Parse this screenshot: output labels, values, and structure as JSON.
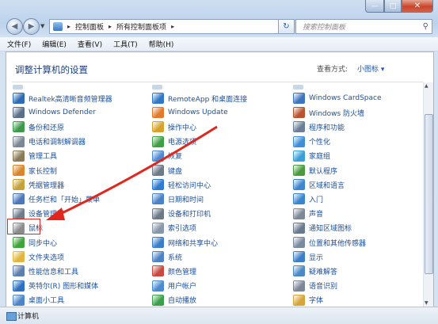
{
  "window": {
    "min_glyph": "—",
    "max_glyph": "□",
    "close_glyph": "✕"
  },
  "nav": {
    "back_glyph": "◀",
    "forward_glyph": "▶",
    "breadcrumbs": [
      "控制面板",
      "所有控制面板项"
    ],
    "breadcrumb_sep": "▸",
    "search_placeholder": "搜索控制面板",
    "refresh_glyph": "↻",
    "search_glyph": "⚲"
  },
  "menu": [
    {
      "label": "文件(F)"
    },
    {
      "label": "编辑(E)"
    },
    {
      "label": "查看(V)"
    },
    {
      "label": "工具(T)"
    },
    {
      "label": "帮助(H)"
    }
  ],
  "header": {
    "title": "调整计算机的设置",
    "view_by_label": "查看方式:",
    "view_by_value": "小图标 ▾"
  },
  "columns": [
    [
      {
        "label": "Realtek高清晰音频管理器",
        "icon": "speaker-icon",
        "color": "#2e6db4"
      },
      {
        "label": "Windows Defender",
        "icon": "shield-icon",
        "color": "#5b6f8a"
      },
      {
        "label": "备份和还原",
        "icon": "backup-icon",
        "color": "#3c9a4a"
      },
      {
        "label": "电话和调制解调器",
        "icon": "phone-icon",
        "color": "#7c8796"
      },
      {
        "label": "管理工具",
        "icon": "tools-icon",
        "color": "#8a7a55"
      },
      {
        "label": "家长控制",
        "icon": "parental-icon",
        "color": "#d9862b"
      },
      {
        "label": "凭据管理器",
        "icon": "credential-icon",
        "color": "#c4a23a"
      },
      {
        "label": "任务栏和「开始」菜单",
        "icon": "taskbar-icon",
        "color": "#4c77b8"
      },
      {
        "label": "设备管理器",
        "icon": "device-manager-icon",
        "color": "#6f7c8c"
      },
      {
        "label": "鼠标",
        "icon": "mouse-icon",
        "color": "#8c8c8c"
      },
      {
        "label": "同步中心",
        "icon": "sync-icon",
        "color": "#3ea43b"
      },
      {
        "label": "文件夹选项",
        "icon": "folder-icon",
        "color": "#e2b63f"
      },
      {
        "label": "性能信息和工具",
        "icon": "performance-icon",
        "color": "#5d7fb0"
      },
      {
        "label": "英特尔(R) 图形和媒体",
        "icon": "intel-icon",
        "color": "#2d70c2"
      },
      {
        "label": "桌面小工具",
        "icon": "gadgets-icon",
        "color": "#4d86c8"
      }
    ],
    [
      {
        "label": "RemoteApp 和桌面连接",
        "icon": "remoteapp-icon",
        "color": "#3178c6"
      },
      {
        "label": "Windows Update",
        "icon": "update-icon",
        "color": "#e27a2b"
      },
      {
        "label": "操作中心",
        "icon": "flag-icon",
        "color": "#d7a22a"
      },
      {
        "label": "电源选项",
        "icon": "power-icon",
        "color": "#3ea044"
      },
      {
        "label": "恢复",
        "icon": "recovery-icon",
        "color": "#4d8ad1"
      },
      {
        "label": "键盘",
        "icon": "keyboard-icon",
        "color": "#6f7a88"
      },
      {
        "label": "轻松访问中心",
        "icon": "ease-access-icon",
        "color": "#2e7bd0"
      },
      {
        "label": "日期和时间",
        "icon": "clock-icon",
        "color": "#4b82c9"
      },
      {
        "label": "设备和打印机",
        "icon": "printer-icon",
        "color": "#6c7886"
      },
      {
        "label": "索引选项",
        "icon": "index-icon",
        "color": "#8796a8"
      },
      {
        "label": "网络和共享中心",
        "icon": "network-icon",
        "color": "#3b7fc8"
      },
      {
        "label": "系统",
        "icon": "system-icon",
        "color": "#4f83c4"
      },
      {
        "label": "颜色管理",
        "icon": "color-icon",
        "color": "#c9483f"
      },
      {
        "label": "用户帐户",
        "icon": "user-icon",
        "color": "#4a8ad0"
      },
      {
        "label": "自动播放",
        "icon": "autoplay-icon",
        "color": "#3ba04a"
      }
    ],
    [
      {
        "label": "Windows CardSpace",
        "icon": "cardspace-icon",
        "color": "#3c74c0"
      },
      {
        "label": "Windows 防火墙",
        "icon": "firewall-icon",
        "color": "#b9532f"
      },
      {
        "label": "程序和功能",
        "icon": "programs-icon",
        "color": "#6d7f97"
      },
      {
        "label": "个性化",
        "icon": "personalize-icon",
        "color": "#3d8fd8"
      },
      {
        "label": "家庭组",
        "icon": "homegroup-icon",
        "color": "#3a9fd6"
      },
      {
        "label": "默认程序",
        "icon": "default-programs-icon",
        "color": "#4a9a3f"
      },
      {
        "label": "区域和语言",
        "icon": "region-icon",
        "color": "#3f86cf"
      },
      {
        "label": "入门",
        "icon": "getting-started-icon",
        "color": "#3a85cf"
      },
      {
        "label": "声音",
        "icon": "sound-icon",
        "color": "#7c8898"
      },
      {
        "label": "通知区域图标",
        "icon": "notification-icon",
        "color": "#6a7a8e"
      },
      {
        "label": "位置和其他传感器",
        "icon": "sensor-icon",
        "color": "#7a8aa0"
      },
      {
        "label": "显示",
        "icon": "display-icon",
        "color": "#3c7fc8"
      },
      {
        "label": "疑难解答",
        "icon": "troubleshoot-icon",
        "color": "#4b88c6"
      },
      {
        "label": "语音识别",
        "icon": "mic-icon",
        "color": "#7c8696"
      },
      {
        "label": "字体",
        "icon": "font-icon",
        "color": "#d6a43a"
      }
    ]
  ],
  "status": {
    "text": "计算机"
  },
  "annotation": {
    "color": "#e0261d"
  }
}
